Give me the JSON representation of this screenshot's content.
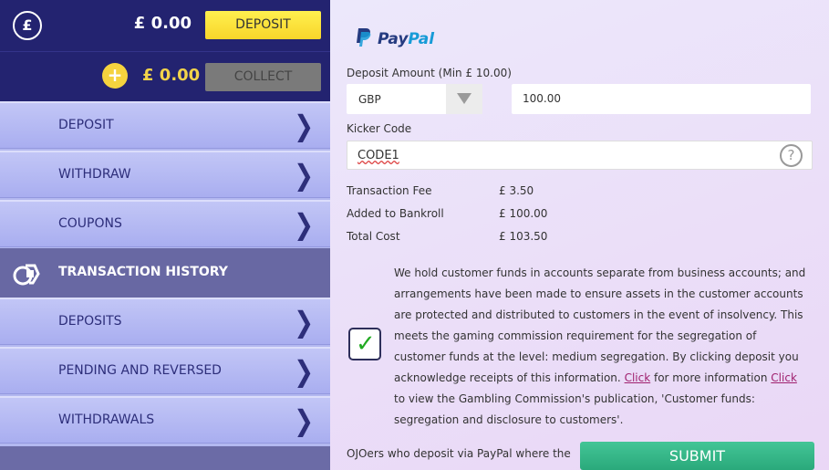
{
  "balance": {
    "main": "£ 0.00",
    "bonus": "£ 0.00"
  },
  "buttons": {
    "deposit": "DEPOSIT",
    "collect": "COLLECT"
  },
  "menu": [
    {
      "label": "DEPOSIT"
    },
    {
      "label": "WITHDRAW"
    },
    {
      "label": "COUPONS"
    }
  ],
  "transaction_history": {
    "label": "TRANSACTION HISTORY",
    "items": [
      {
        "label": "DEPOSITS"
      },
      {
        "label": "PENDING AND REVERSED"
      },
      {
        "label": "WITHDRAWALS"
      }
    ]
  },
  "icons": {
    "pound": "£",
    "plus": "+",
    "chevron": "❯",
    "help": "?",
    "check": "✓"
  },
  "paypal": {
    "pay": "Pay",
    "pal": "Pal"
  },
  "form": {
    "deposit_amount_label": "Deposit Amount  (Min  £ 10.00)",
    "currency": "GBP",
    "amount": "100.00",
    "kicker_code_label": "Kicker Code",
    "kicker_code": "CODE1"
  },
  "summary": [
    {
      "label": "Transaction Fee",
      "value": "£ 3.50"
    },
    {
      "label": "Added to Bankroll",
      "value": "£ 100.00"
    },
    {
      "label": "Total Cost",
      "value": "£ 103.50"
    }
  ],
  "disclaimer": {
    "part1": "We hold customer funds in accounts separate from business accounts; and arrangements have been made to ensure assets in the customer accounts are protected and distributed to customers in the event of insolvency. This meets the gaming commission requirement for the segregation of customer funds at the level: medium segregation. By clicking deposit you acknowledge receipts of this information.",
    "link1": "Click",
    "part2": "for more information",
    "link2": "Click",
    "part3": "to view the Gambling Commission's publication, 'Customer funds: segregation and disclosure to customers'."
  },
  "bottom_note": "OJOers who deposit via PayPal where the",
  "submit_label": "SUBMIT",
  "colors": {
    "header": "#232370",
    "menu": "#b3b8f0",
    "section": "#6868a3",
    "deposit_button": "#f8d52a",
    "submit": "#2aa97b",
    "link": "#a0216f"
  }
}
